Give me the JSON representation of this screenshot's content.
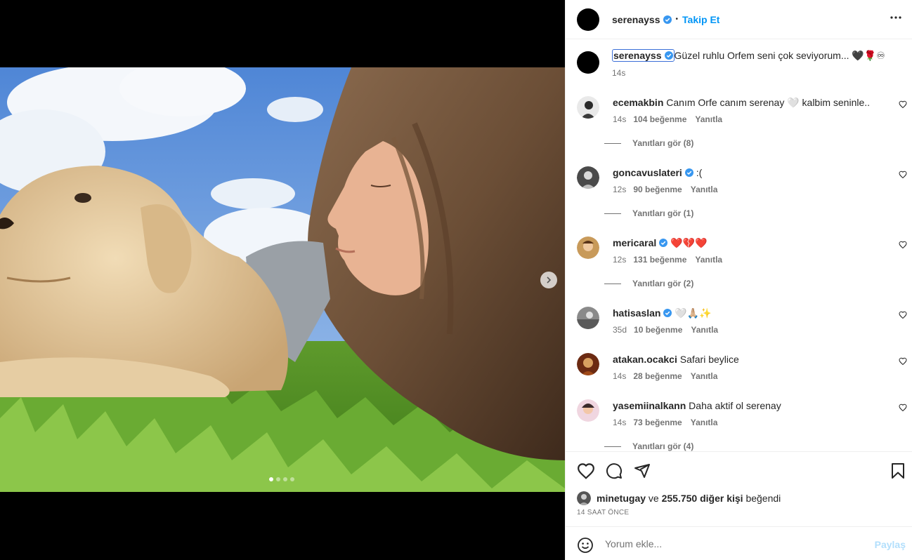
{
  "post": {
    "username": "serenayss",
    "follow_label": "Takip Et",
    "separator": "•",
    "caption": "Güzel ruhlu Orfem seni çok seviyorum... 🖤🌹♾",
    "caption_time": "14s",
    "carousel": {
      "slides": 4,
      "active": 1
    }
  },
  "comments": [
    {
      "user": "ecemakbin",
      "verified": false,
      "text": "Canım Orfe canım serenay 🤍 kalbim seninle..",
      "time": "14s",
      "likes": "104 beğenme",
      "reply": "Yanıtla",
      "replies": "Yanıtları gör (8)"
    },
    {
      "user": "goncavuslateri",
      "verified": true,
      "text": ":(",
      "time": "12s",
      "likes": "90 beğenme",
      "reply": "Yanıtla",
      "replies": "Yanıtları gör (1)"
    },
    {
      "user": "mericaral",
      "verified": true,
      "text": "❤️💔❤️",
      "time": "12s",
      "likes": "131 beğenme",
      "reply": "Yanıtla",
      "replies": "Yanıtları gör (2)"
    },
    {
      "user": "hatisaslan",
      "verified": true,
      "text": "🤍🙏🏼✨",
      "time": "35d",
      "likes": "10 beğenme",
      "reply": "Yanıtla",
      "replies": ""
    },
    {
      "user": "atakan.ocakci",
      "verified": false,
      "text": "Safari beylice",
      "time": "14s",
      "likes": "28 beğenme",
      "reply": "Yanıtla",
      "replies": ""
    },
    {
      "user": "yasemiinalkann",
      "verified": false,
      "text": "Daha aktif ol serenay",
      "time": "14s",
      "likes": "73 beğenme",
      "reply": "Yanıtla",
      "replies": "Yanıtları gör (4)"
    }
  ],
  "likes_line": {
    "user": "minetugay",
    "connector": "ve",
    "others": "255.750 diğer kişi",
    "suffix": "beğendi"
  },
  "time_ago": "14 SAAT ÖNCE",
  "add_comment": {
    "placeholder": "Yorum ekle...",
    "post_label": "Paylaş"
  },
  "colors": {
    "accent": "#0095f6",
    "verified": "#3897f0",
    "muted": "#737373"
  }
}
